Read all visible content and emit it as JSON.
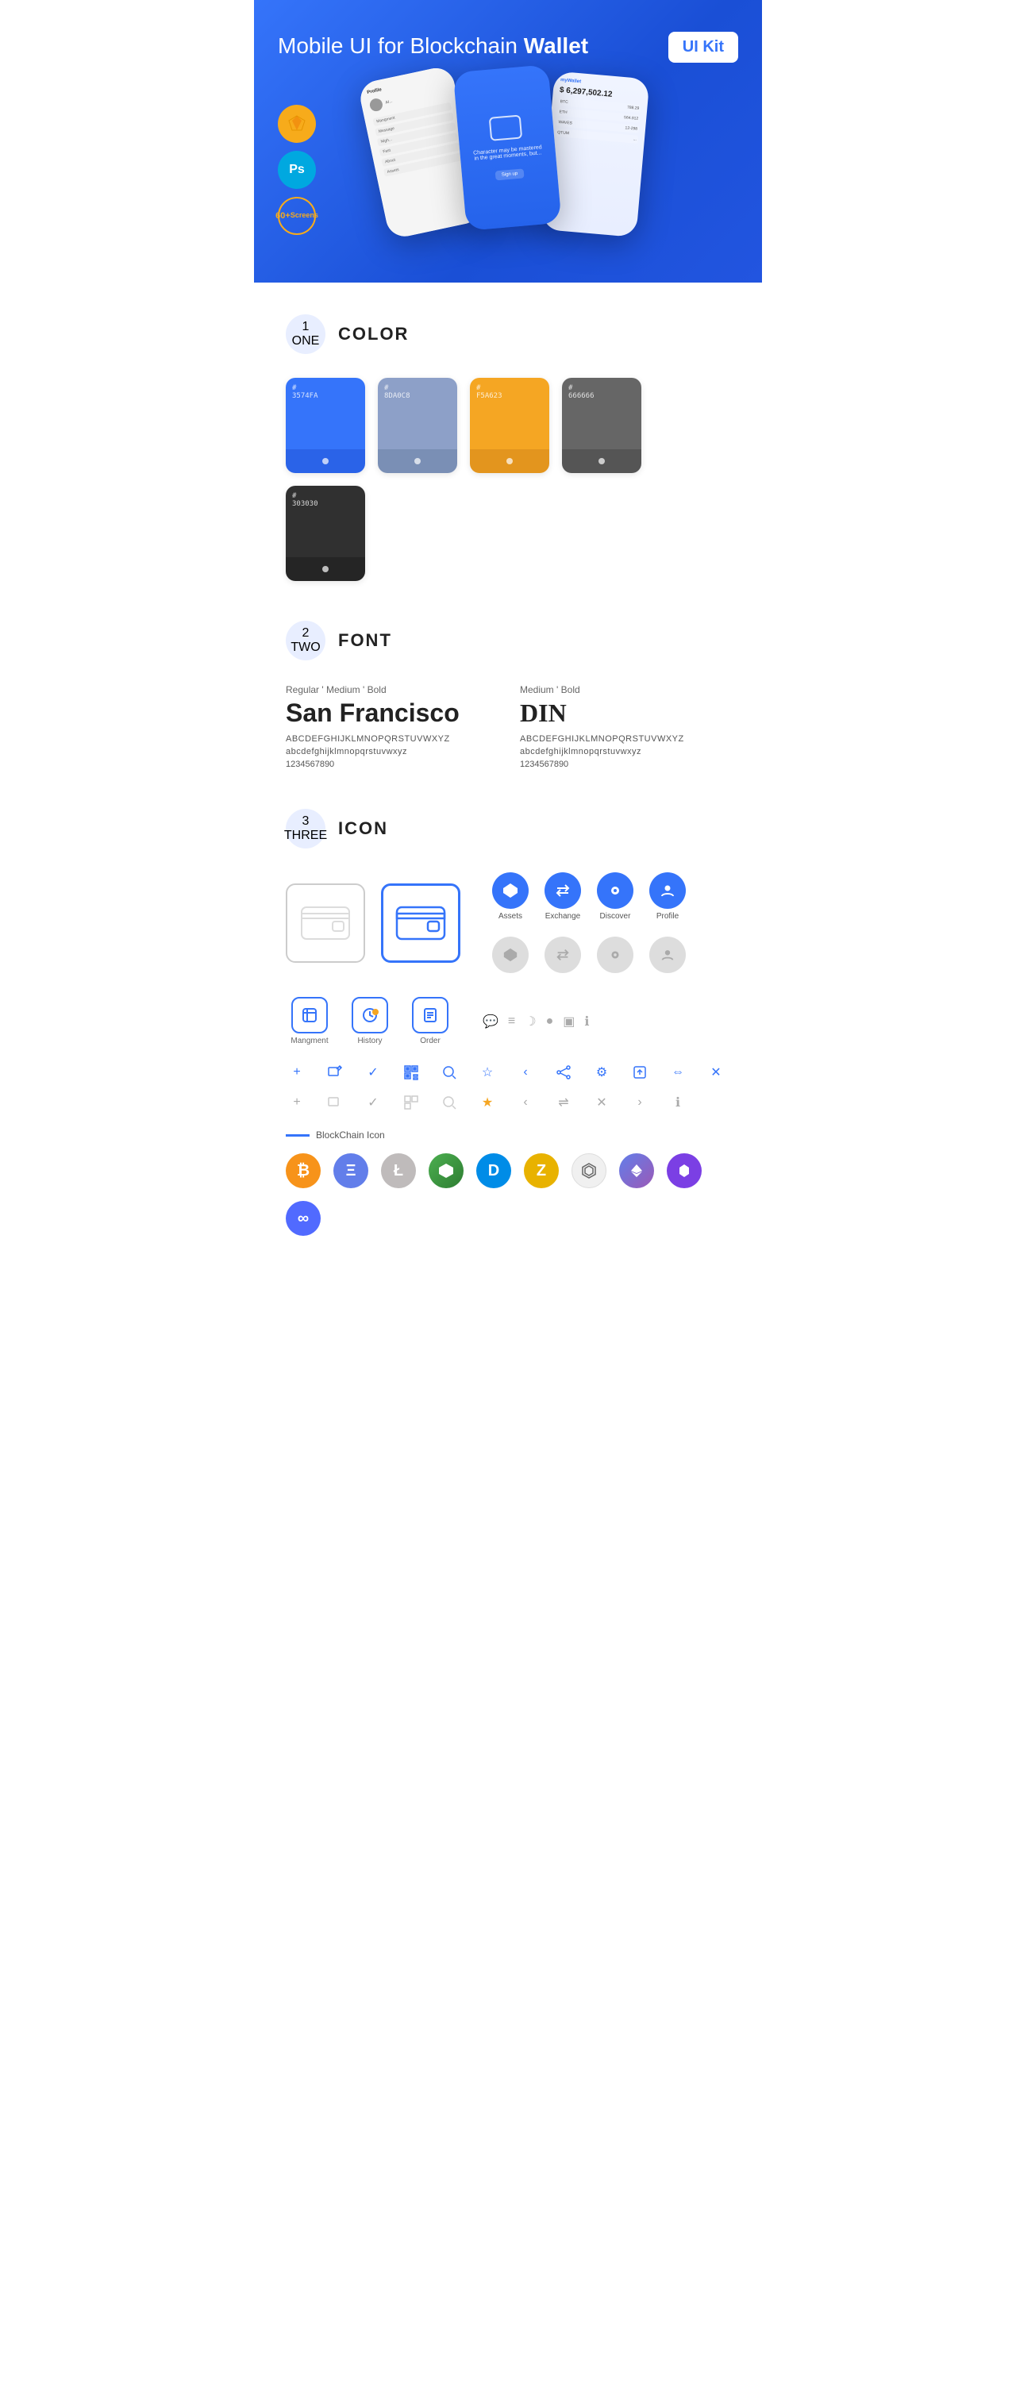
{
  "hero": {
    "title": "Mobile UI for Blockchain ",
    "title_bold": "Wallet",
    "badge": "UI Kit",
    "badges": [
      {
        "label": "Sk",
        "type": "sketch"
      },
      {
        "label": "Ps",
        "type": "ps"
      },
      {
        "label": "60+\nScreens",
        "type": "screens"
      }
    ]
  },
  "sections": {
    "color": {
      "number": "1",
      "word": "ONE",
      "title": "COLOR",
      "swatches": [
        {
          "color": "#3574FA",
          "code": "#\n3574FA"
        },
        {
          "color": "#8DA0C8",
          "code": "#\n8DA0C8"
        },
        {
          "color": "#F5A623",
          "code": "#\nF5A623"
        },
        {
          "color": "#666666",
          "code": "#\n666666"
        },
        {
          "color": "#303030",
          "code": "#\n303030"
        }
      ]
    },
    "font": {
      "number": "2",
      "word": "TWO",
      "title": "FONT",
      "fonts": [
        {
          "subtitle": "Regular ' Medium ' Bold",
          "name": "San Francisco",
          "upper": "ABCDEFGHIJKLMNOPQRSTUVWXYZ",
          "lower": "abcdefghijklmnopqrstuvwxyz",
          "numbers": "1234567890"
        },
        {
          "subtitle": "Medium ' Bold",
          "name": "DIN",
          "upper": "ABCDEFGHIJKLMNOPQRSTUVWXYZ",
          "lower": "abcdefghijklmnopqrstuvwxyz",
          "numbers": "1234567890"
        }
      ]
    },
    "icon": {
      "number": "3",
      "word": "THREE",
      "title": "ICON",
      "nav_icons": [
        {
          "label": "Assets",
          "active": true
        },
        {
          "label": "Exchange",
          "active": true
        },
        {
          "label": "Discover",
          "active": true
        },
        {
          "label": "Profile",
          "active": true
        }
      ],
      "bottom_icons": [
        {
          "label": "Mangment"
        },
        {
          "label": "History"
        },
        {
          "label": "Order"
        }
      ],
      "blockchain_label": "BlockChain Icon",
      "crypto_icons": [
        {
          "symbol": "₿",
          "class": "crypto-btc"
        },
        {
          "symbol": "Ξ",
          "class": "crypto-eth"
        },
        {
          "symbol": "Ł",
          "class": "crypto-ltc"
        },
        {
          "symbol": "◈",
          "class": "crypto-neo"
        },
        {
          "symbol": "D",
          "class": "crypto-dash"
        },
        {
          "symbol": "Z",
          "class": "crypto-zcash"
        },
        {
          "symbol": "⬡",
          "class": "crypto-hex"
        },
        {
          "symbol": "⬟",
          "class": "crypto-eth2"
        },
        {
          "symbol": "◆",
          "class": "crypto-poly"
        },
        {
          "symbol": "∞",
          "class": "crypto-band"
        }
      ]
    }
  }
}
